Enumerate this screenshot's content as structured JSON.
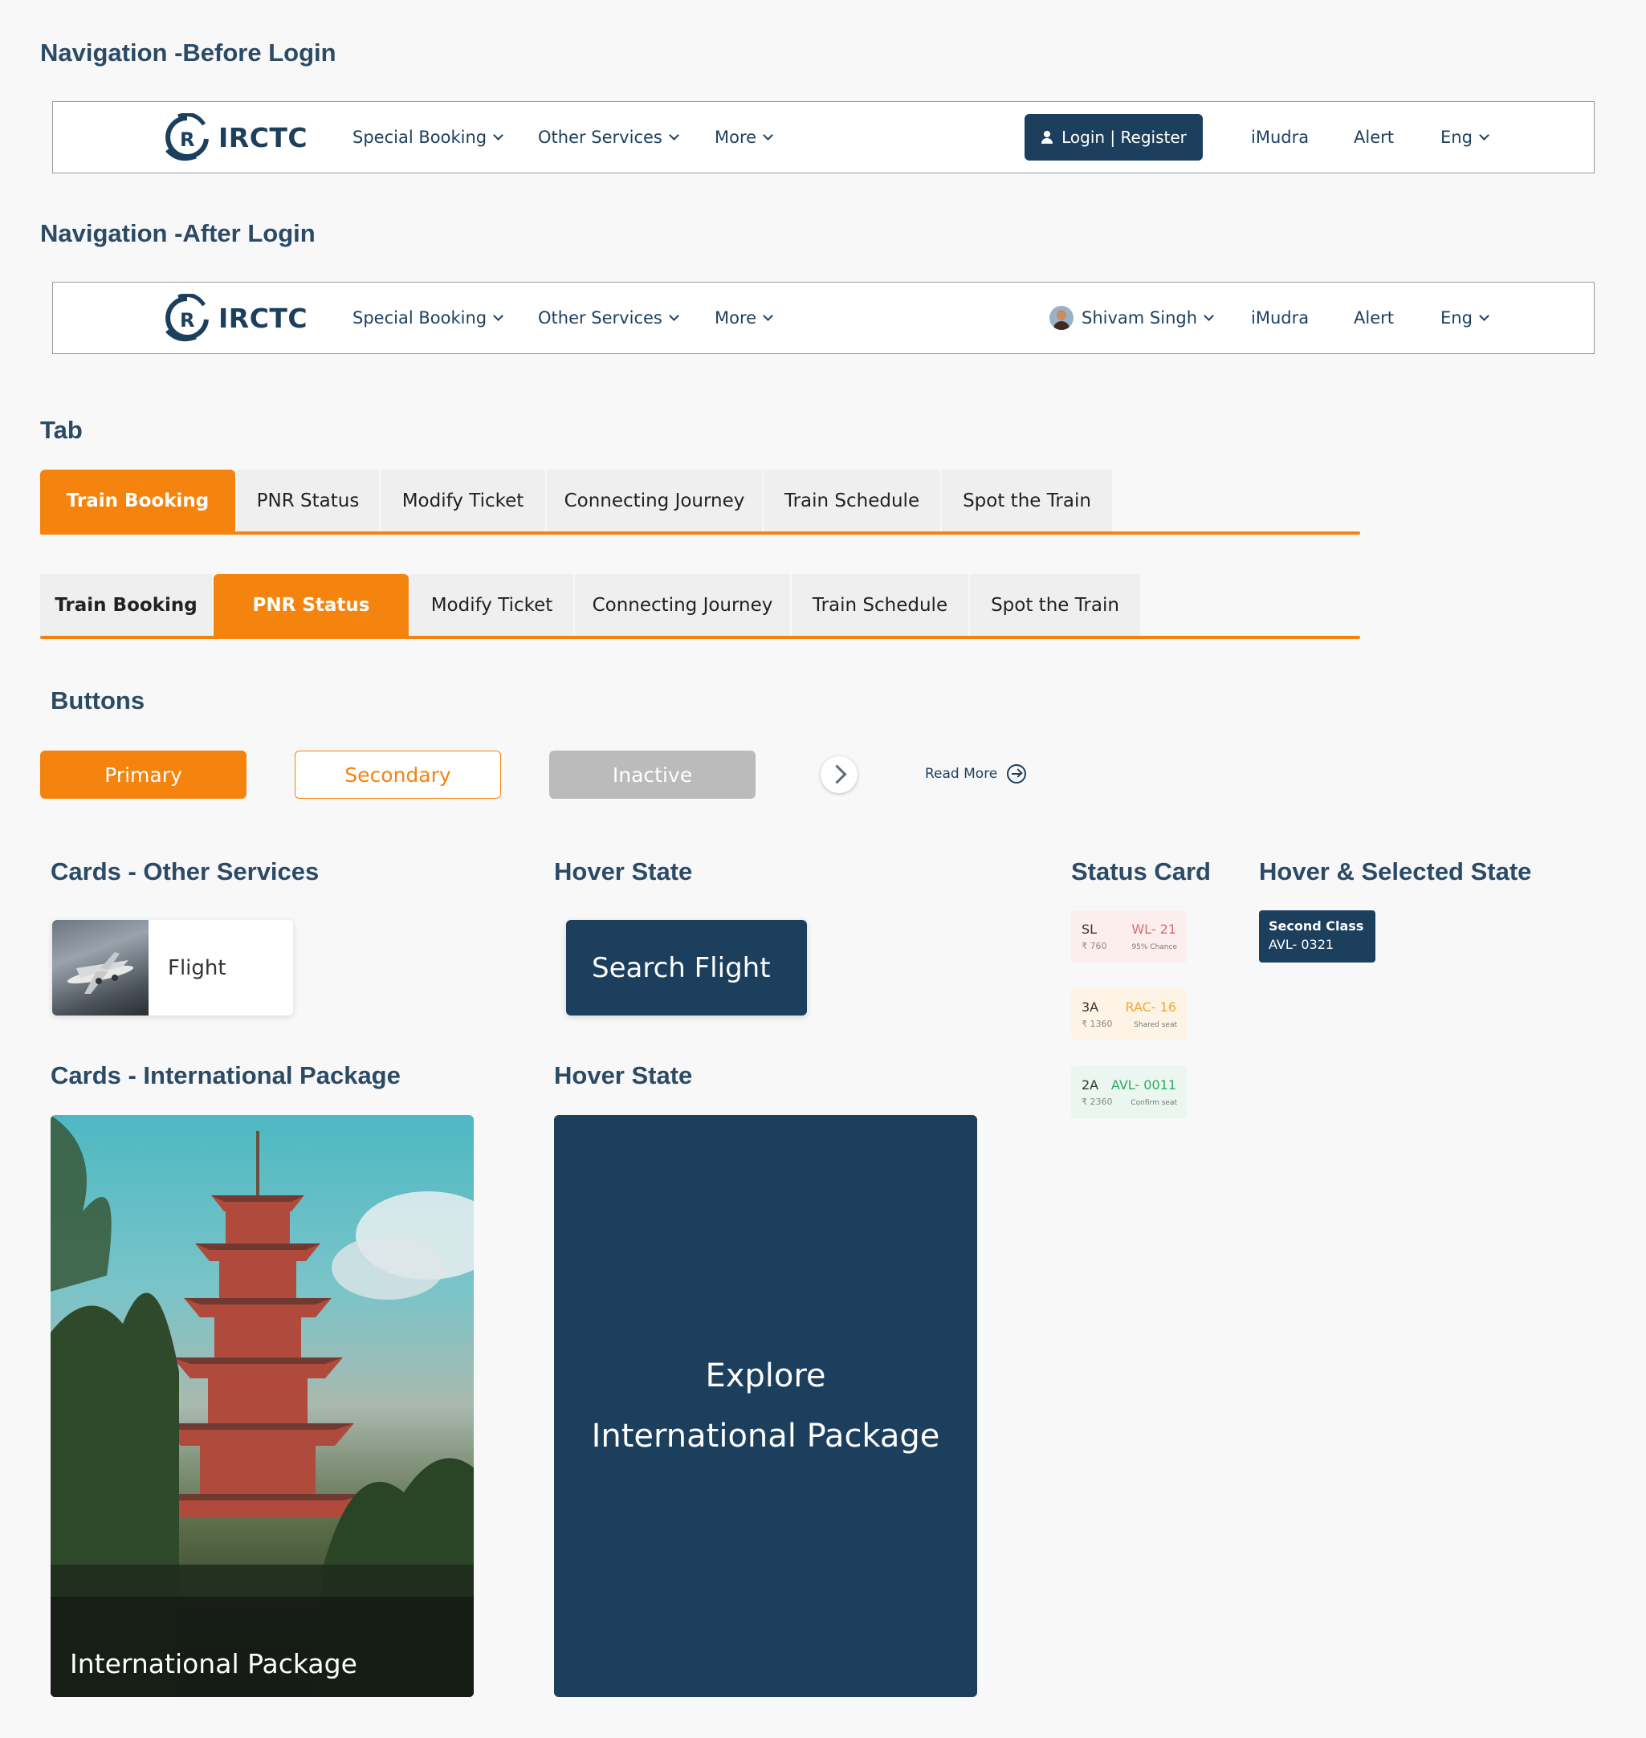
{
  "sections": {
    "nav_before": "Navigation -Before Login",
    "nav_after": "Navigation -After Login",
    "tab": "Tab",
    "buttons": "Buttons",
    "cards_other": "Cards - Other Services",
    "hover_state": "Hover State",
    "status_card": "Status Card",
    "hover_selected": "Hover & Selected State",
    "cards_intl": "Cards - International Package",
    "hover_state_2": "Hover State"
  },
  "nav": {
    "logo_text": "IRCTC",
    "special_booking": "Special Booking",
    "other_services": "Other Services",
    "more": "More",
    "login_register": "Login | Register",
    "imudra": "iMudra",
    "alert": "Alert",
    "lang": "Eng",
    "user_name": "Shivam Singh"
  },
  "tabs": [
    "Train Booking",
    "PNR Status",
    "Modify Ticket",
    "Connecting Journey",
    "Train Schedule",
    "Spot the Train"
  ],
  "buttons": {
    "primary": "Primary",
    "secondary": "Secondary",
    "inactive": "Inactive",
    "read_more": "Read More"
  },
  "cards": {
    "service_label": "Flight",
    "service_hover": "Search Flight",
    "package_label": "International Package",
    "package_hover_line1": "Explore",
    "package_hover_line2": "International Package"
  },
  "status_cards": [
    {
      "cls": "SL",
      "price": "₹ 760",
      "avail": "WL- 21",
      "note": "95% Chance",
      "bg": "#fdeeee",
      "color": "#e06868"
    },
    {
      "cls": "3A",
      "price": "₹ 1360",
      "avail": "RAC- 16",
      "note": "Shared seat",
      "bg": "#fdf4e6",
      "color": "#f0a830"
    },
    {
      "cls": "2A",
      "price": "₹ 2360",
      "avail": "AVL- 0011",
      "note": "Confirm seat",
      "bg": "#eaf6ef",
      "color": "#2eaa66"
    }
  ],
  "selected_card": {
    "line1": "Second Class",
    "line2": "AVL- 0321"
  },
  "colors": {
    "brand_navy": "#1c3f5e",
    "accent_orange": "#f5840e",
    "inactive_gray": "#bbbbbb"
  }
}
